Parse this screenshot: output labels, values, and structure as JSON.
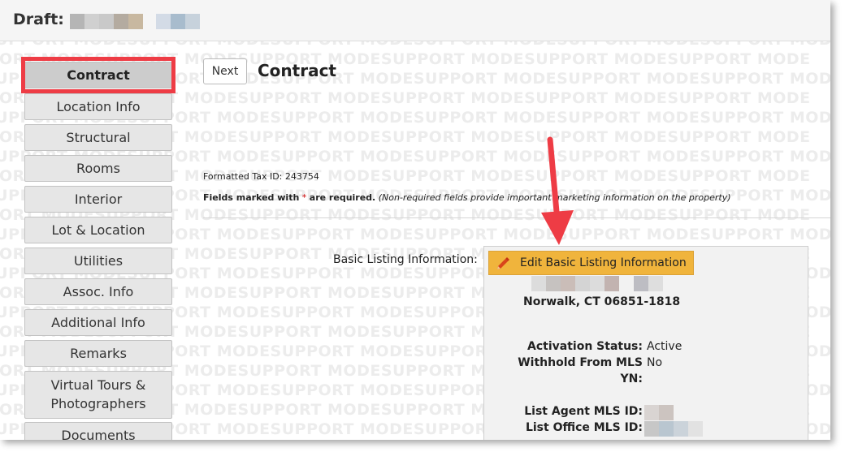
{
  "header": {
    "draft_label": "Draft:"
  },
  "sidebar": {
    "items": [
      {
        "label": "Contract",
        "active": true
      },
      {
        "label": "Location Info"
      },
      {
        "label": "Structural"
      },
      {
        "label": "Rooms"
      },
      {
        "label": "Interior"
      },
      {
        "label": "Lot & Location"
      },
      {
        "label": "Utilities"
      },
      {
        "label": "Assoc. Info"
      },
      {
        "label": "Additional Info"
      },
      {
        "label": "Remarks"
      },
      {
        "label_line1": "Virtual Tours &",
        "label_line2": "Photographers"
      },
      {
        "label": "Documents"
      }
    ]
  },
  "main": {
    "next_label": "Next",
    "title": "Contract",
    "tax_id": "Formatted Tax ID: 243754",
    "required_bold_a": "Fields marked with",
    "required_star": "*",
    "required_bold_b": "are required.",
    "required_note": "(Non-required fields provide important marketing information on the property)",
    "basic_listing_label": "Basic Listing Information:",
    "edit_button_label": "Edit Basic Listing Information",
    "address_city": "Norwalk, CT 06851-1818",
    "activation_status_label": "Activation Status:",
    "activation_status_value": "Active",
    "withhold_label_line1": "Withhold From MLS",
    "withhold_label_line2": "YN:",
    "withhold_value": "No",
    "list_agent_label": "List Agent MLS ID:",
    "list_office_label": "List Office MLS ID:"
  },
  "watermark_text": "SUPPORT MODESUPPORT MODESUPPORT MODESUPPORT MODESUPPORT MODESUPPORT MODE",
  "colors": {
    "highlight_red": "#ee3c45",
    "edit_button": "#f0b43c",
    "arrow_red": "#ee3c45"
  }
}
